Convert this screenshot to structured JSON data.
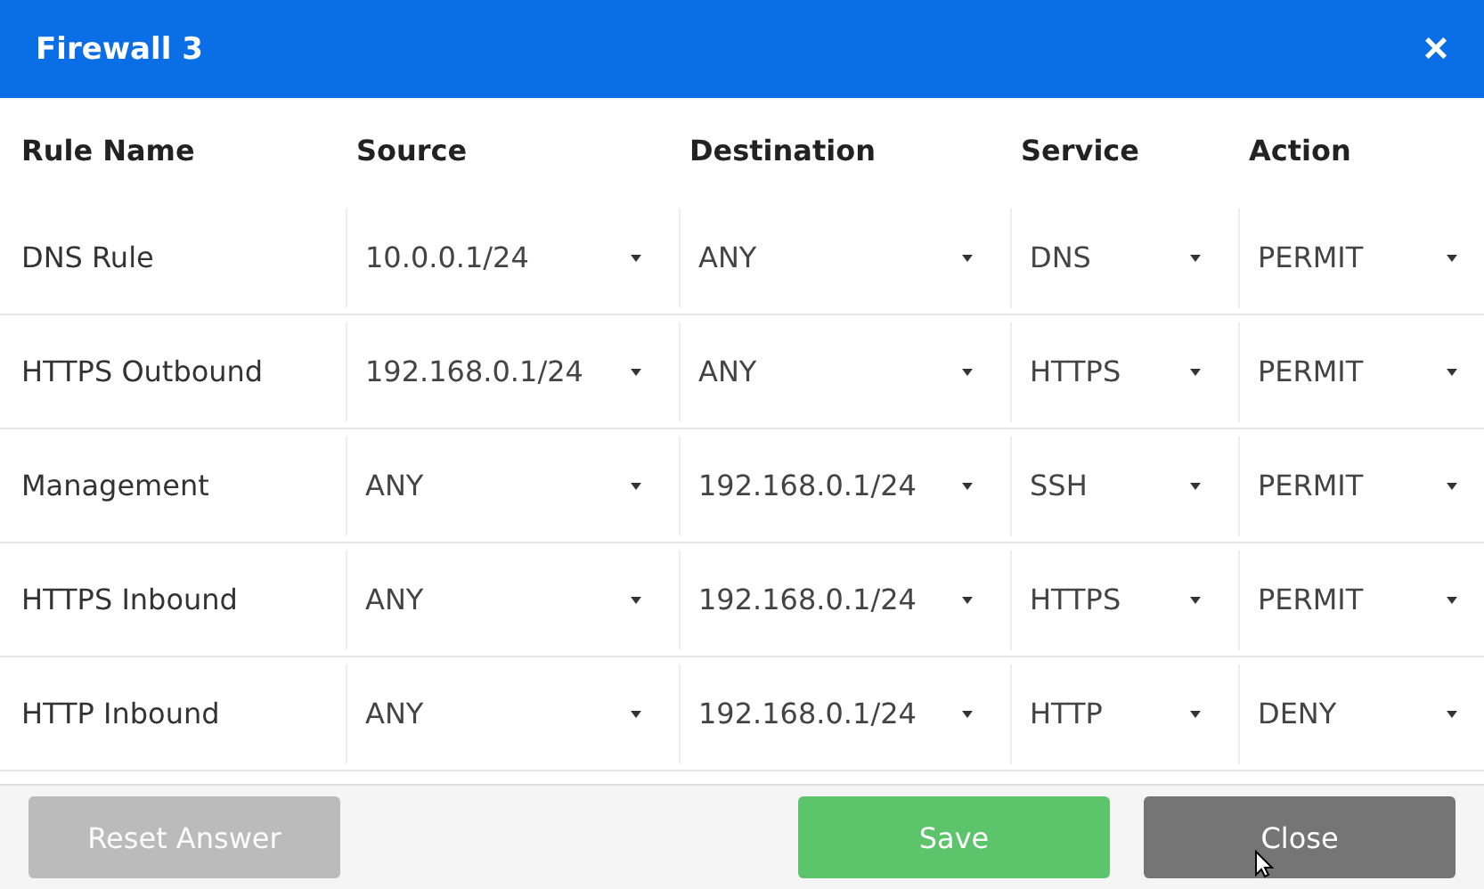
{
  "window": {
    "title": "Firewall 3",
    "close": "×"
  },
  "table": {
    "columns": [
      "Rule Name",
      "Source",
      "Destination",
      "Service",
      "Action"
    ],
    "rows": [
      {
        "name": "DNS Rule",
        "source": "10.0.0.1/24",
        "destination": "ANY",
        "service": "DNS",
        "action": "PERMIT"
      },
      {
        "name": "HTTPS Outbound",
        "source": "192.168.0.1/24",
        "destination": "ANY",
        "service": "HTTPS",
        "action": "PERMIT"
      },
      {
        "name": "Management",
        "source": "ANY",
        "destination": "192.168.0.1/24",
        "service": "SSH",
        "action": "PERMIT"
      },
      {
        "name": "HTTPS Inbound",
        "source": "ANY",
        "destination": "192.168.0.1/24",
        "service": "HTTPS",
        "action": "PERMIT"
      },
      {
        "name": "HTTP Inbound",
        "source": "ANY",
        "destination": "192.168.0.1/24",
        "service": "HTTP",
        "action": "DENY"
      }
    ]
  },
  "buttons": [
    {
      "label": "Reset Answer",
      "kind": "reset",
      "disabled": true
    },
    {
      "label": "Save",
      "kind": "save",
      "disabled": false
    },
    {
      "label": "Close",
      "kind": "close",
      "disabled": false
    }
  ]
}
